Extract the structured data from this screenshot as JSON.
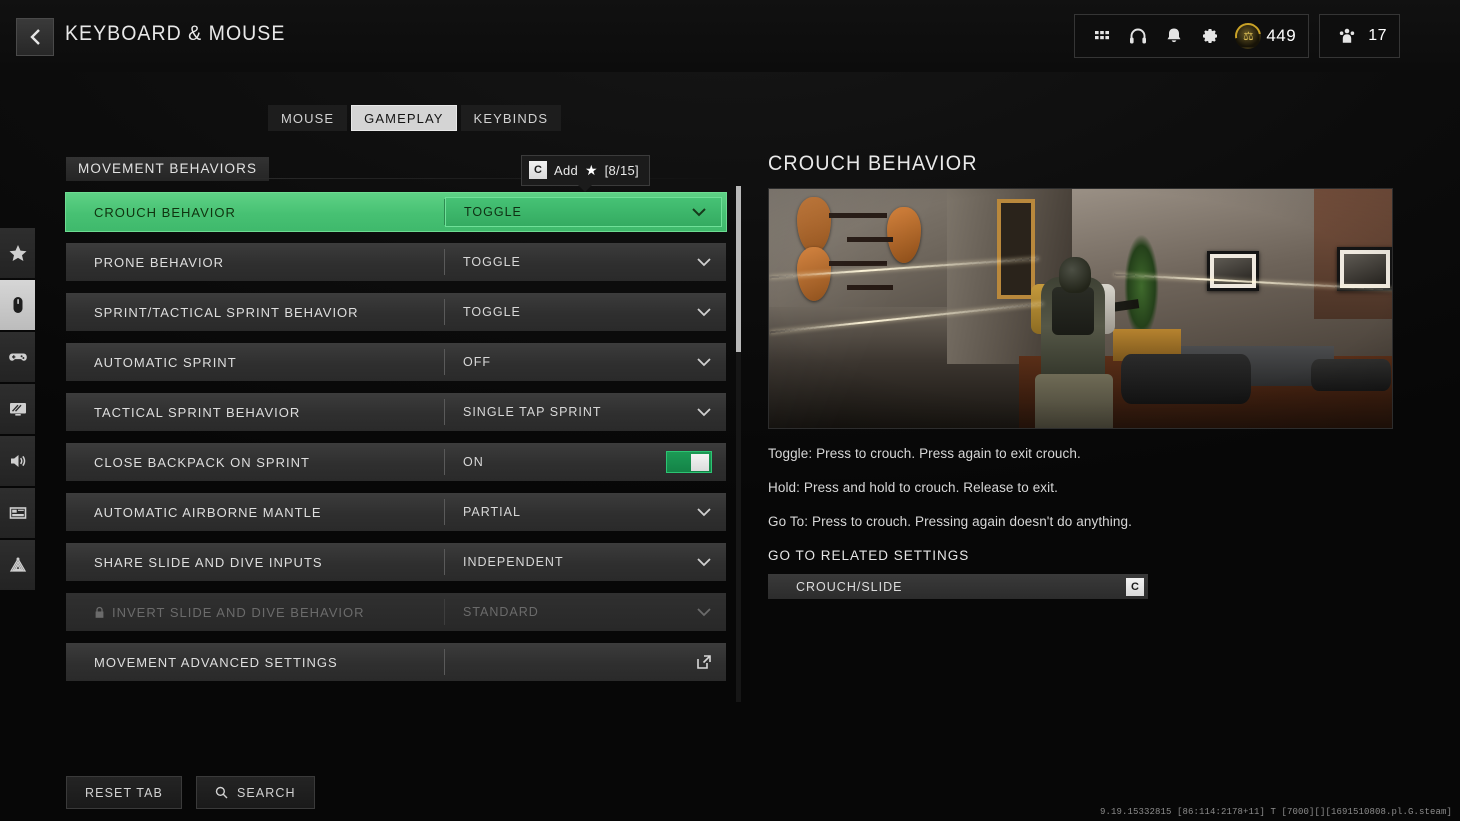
{
  "header": {
    "back_icon": "chevron-left-icon",
    "title": "KEYBOARD & MOUSE",
    "icons": [
      {
        "name": "apps-grid-icon",
        "glyph": "grid"
      },
      {
        "name": "headphones-icon",
        "glyph": "headset"
      },
      {
        "name": "notification-bell-icon",
        "glyph": "bell"
      },
      {
        "name": "settings-gear-icon",
        "glyph": "gear"
      }
    ],
    "currency": {
      "icon": "battlepass-coin-icon",
      "amount": "449"
    },
    "squad": {
      "icon": "squad-members-icon",
      "count": "17"
    }
  },
  "sidebar": {
    "items": [
      {
        "name": "favorites",
        "icon": "star-icon",
        "active": false
      },
      {
        "name": "keyboard-mouse",
        "icon": "mouse-icon",
        "active": true
      },
      {
        "name": "controller",
        "icon": "gamepad-icon",
        "active": false
      },
      {
        "name": "graphics",
        "icon": "monitor-icon",
        "active": false
      },
      {
        "name": "audio",
        "icon": "speaker-icon",
        "active": false
      },
      {
        "name": "interface",
        "icon": "layout-icon",
        "active": false
      },
      {
        "name": "accessibility",
        "icon": "broadcast-icon",
        "active": false
      }
    ]
  },
  "tabs": [
    {
      "label": "MOUSE",
      "active": false
    },
    {
      "label": "GAMEPLAY",
      "active": true
    },
    {
      "label": "KEYBINDS",
      "active": false
    }
  ],
  "settings": {
    "section_title": "MOVEMENT BEHAVIORS",
    "tooltip": {
      "key": "C",
      "action": "Add",
      "star": "★",
      "count": "[8/15]"
    },
    "rows": [
      {
        "label": "CROUCH BEHAVIOR",
        "value": "TOGGLE",
        "control": "dropdown",
        "state": "selected"
      },
      {
        "label": "PRONE BEHAVIOR",
        "value": "TOGGLE",
        "control": "dropdown",
        "state": "normal"
      },
      {
        "label": "SPRINT/TACTICAL SPRINT BEHAVIOR",
        "value": "TOGGLE",
        "control": "dropdown",
        "state": "normal"
      },
      {
        "label": "AUTOMATIC SPRINT",
        "value": "OFF",
        "control": "dropdown",
        "state": "normal"
      },
      {
        "label": "TACTICAL SPRINT BEHAVIOR",
        "value": "SINGLE TAP SPRINT",
        "control": "dropdown",
        "state": "normal"
      },
      {
        "label": "CLOSE BACKPACK ON SPRINT",
        "value": "ON",
        "control": "toggle",
        "state": "normal"
      },
      {
        "label": "AUTOMATIC AIRBORNE MANTLE",
        "value": "PARTIAL",
        "control": "dropdown",
        "state": "normal"
      },
      {
        "label": "SHARE SLIDE AND DIVE INPUTS",
        "value": "INDEPENDENT",
        "control": "dropdown",
        "state": "normal"
      },
      {
        "label": "INVERT SLIDE AND DIVE BEHAVIOR",
        "value": "STANDARD",
        "control": "dropdown",
        "state": "disabled"
      },
      {
        "label": "MOVEMENT ADVANCED SETTINGS",
        "value": "",
        "control": "external",
        "state": "normal"
      }
    ]
  },
  "detail": {
    "title": "CROUCH BEHAVIOR",
    "preview_alt": "crouching-operator-preview",
    "descriptions": [
      "Toggle: Press to crouch. Press again to exit crouch.",
      "Hold: Press and hold to crouch. Release to exit.",
      "Go To: Press to crouch. Pressing again doesn't do anything."
    ],
    "related_heading": "GO TO RELATED SETTINGS",
    "related": [
      {
        "label": "CROUCH/SLIDE",
        "key": "C"
      }
    ]
  },
  "footer": {
    "reset_label": "RESET TAB",
    "search_label": "SEARCH",
    "search_icon": "magnifier-icon",
    "build": "9.19.15332815 [86:114:2178+11] T [7000][][1691510808.pl.G.steam]"
  },
  "colors": {
    "accent_green": "#47c173",
    "accent_green_light": "#5ed185",
    "toggle_green": "#1c9a55",
    "panel_dark": "#2f2f2f",
    "gold": "#c9a227"
  }
}
